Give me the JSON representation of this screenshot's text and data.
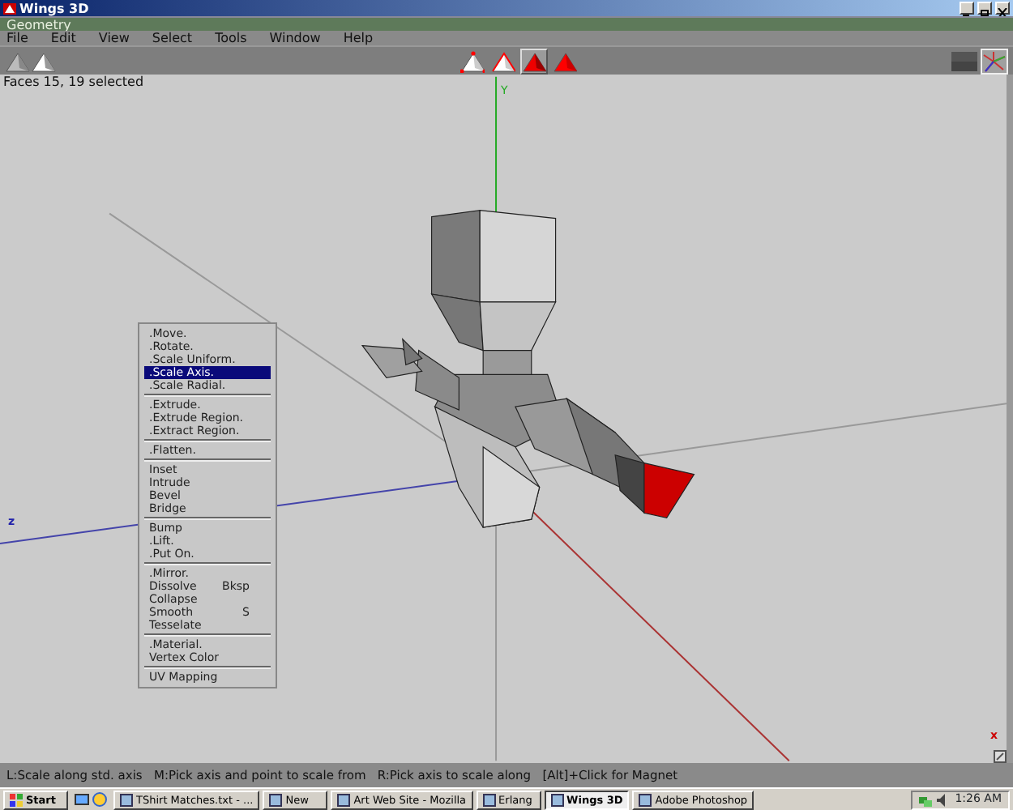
{
  "window": {
    "title": "Wings 3D"
  },
  "geometry_title": "Geometry",
  "menubar": [
    "File",
    "Edit",
    "View",
    "Select",
    "Tools",
    "Window",
    "Help"
  ],
  "select_modes": [
    {
      "kind": "vertex",
      "selected": false
    },
    {
      "kind": "edge",
      "selected": false
    },
    {
      "kind": "face",
      "selected": true
    },
    {
      "kind": "body",
      "selected": false
    }
  ],
  "viewport": {
    "info": "Faces 15, 19 selected",
    "axis_labels": [
      {
        "kind": "y",
        "text": "Y"
      },
      {
        "kind": "z",
        "text": "z"
      },
      {
        "kind": "x",
        "text": "x"
      }
    ]
  },
  "context_menu": {
    "groups": [
      [
        {
          "label": ".Move.",
          "selected": false
        },
        {
          "label": ".Rotate.",
          "selected": false
        },
        {
          "label": ".Scale Uniform.",
          "selected": false
        },
        {
          "label": ".Scale Axis.",
          "selected": true
        },
        {
          "label": ".Scale Radial.",
          "selected": false
        }
      ],
      [
        {
          "label": ".Extrude.",
          "selected": false
        },
        {
          "label": ".Extrude Region.",
          "selected": false
        },
        {
          "label": ".Extract Region.",
          "selected": false
        }
      ],
      [
        {
          "label": ".Flatten.",
          "selected": false
        }
      ],
      [
        {
          "label": "Inset",
          "selected": false
        },
        {
          "label": "Intrude",
          "selected": false
        },
        {
          "label": "Bevel",
          "selected": false
        },
        {
          "label": "Bridge",
          "selected": false
        }
      ],
      [
        {
          "label": "Bump",
          "selected": false
        },
        {
          "label": ".Lift.",
          "selected": false
        },
        {
          "label": ".Put On.",
          "selected": false
        }
      ],
      [
        {
          "label": ".Mirror.",
          "selected": false
        },
        {
          "label": "Dissolve",
          "shortcut": "Bksp",
          "selected": false
        },
        {
          "label": "Collapse",
          "selected": false
        },
        {
          "label": "Smooth",
          "shortcut": "S",
          "selected": false
        },
        {
          "label": "Tesselate",
          "selected": false
        }
      ],
      [
        {
          "label": ".Material.",
          "selected": false
        },
        {
          "label": "Vertex Color",
          "selected": false
        }
      ],
      [
        {
          "label": "UV Mapping",
          "selected": false
        }
      ]
    ]
  },
  "status_bar": "L:Scale along std. axis   M:Pick axis and point to scale from   R:Pick axis to scale along   [Alt]+Click for Magnet",
  "taskbar": {
    "start": "Start",
    "tasks": [
      {
        "label": "TShirt Matches.txt - ...",
        "selected": false
      },
      {
        "label": "New",
        "selected": false
      },
      {
        "label": "Art Web Site - Mozilla",
        "selected": false
      },
      {
        "label": "Erlang",
        "selected": false
      },
      {
        "label": "Wings 3D",
        "selected": true
      },
      {
        "label": "Adobe Photoshop",
        "selected": false
      }
    ],
    "clock": "1:26 AM"
  }
}
